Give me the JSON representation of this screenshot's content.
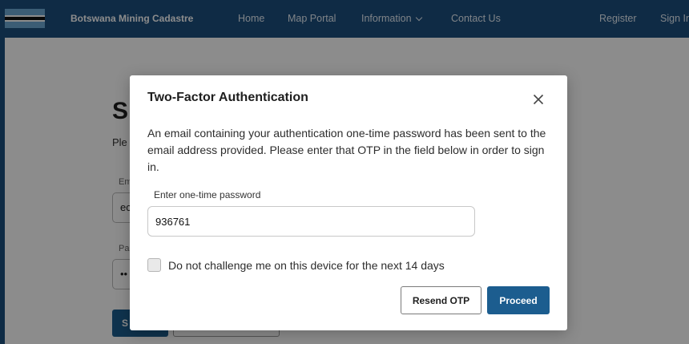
{
  "navbar": {
    "brand": "Botswana Mining Cadastre",
    "links": [
      {
        "label": "Home"
      },
      {
        "label": "Map Portal"
      },
      {
        "label": "Information"
      },
      {
        "label": "Contact Us"
      }
    ],
    "register_label": "Register",
    "signin_label": "Sign In",
    "background_color": "#1c4f7f"
  },
  "background_page": {
    "title_fragment": "S",
    "subtitle_fragment": "Ple",
    "email_label_fragment": "Em",
    "email_value_fragment": "ec",
    "password_label_fragment": "Pa",
    "password_value_fragment": "••",
    "primary_button_fragment": "S"
  },
  "modal": {
    "title": "Two-Factor Authentication",
    "message": "An email containing your authentication one-time password has been sent to the email address provided. Please enter that OTP in the field below in order to sign in.",
    "otp_label": "Enter one-time password",
    "otp_value": "936761",
    "remember_label": "Do not challenge me on this device for the next 14 days",
    "remember_checked": false,
    "resend_label": "Resend OTP",
    "proceed_label": "Proceed",
    "accent_color": "#1c5d8f"
  }
}
